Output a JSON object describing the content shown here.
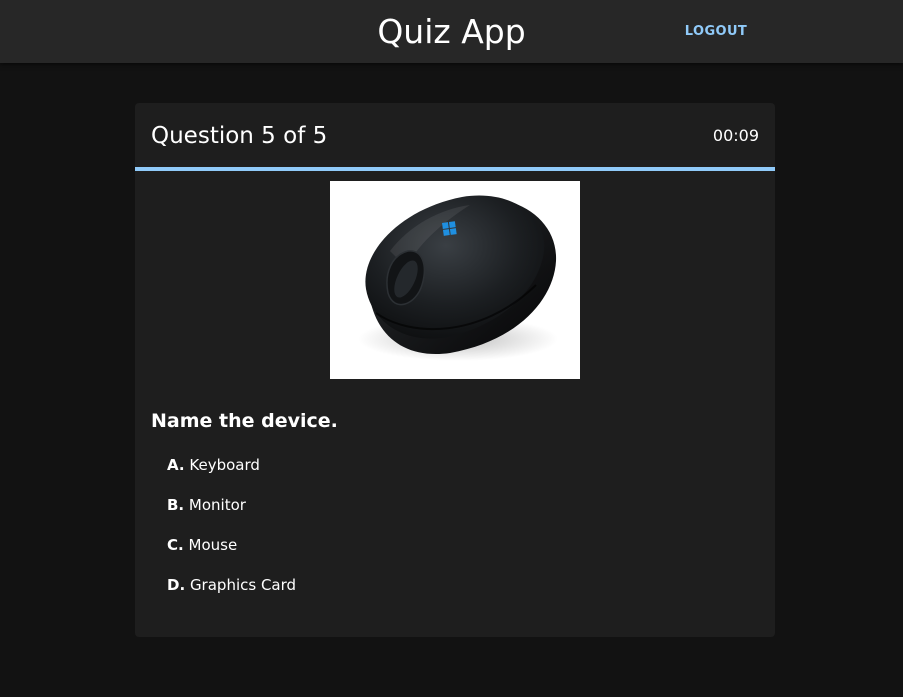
{
  "app": {
    "title": "Quiz App",
    "logout_label": "LOGOUT"
  },
  "quiz": {
    "counter": "Question 5 of 5",
    "timer": "00:09",
    "progress_fraction": 1.0,
    "image_icon": "computer-mouse-image",
    "question": "Name the device.",
    "options": [
      {
        "letter": "A.",
        "text": "Keyboard"
      },
      {
        "letter": "B.",
        "text": "Monitor"
      },
      {
        "letter": "C.",
        "text": "Mouse"
      },
      {
        "letter": "D.",
        "text": "Graphics Card"
      }
    ]
  },
  "colors": {
    "background": "#121212",
    "app_bar": "#272727",
    "card": "#1e1e1e",
    "accent": "#90caf9",
    "text": "#ffffff"
  }
}
